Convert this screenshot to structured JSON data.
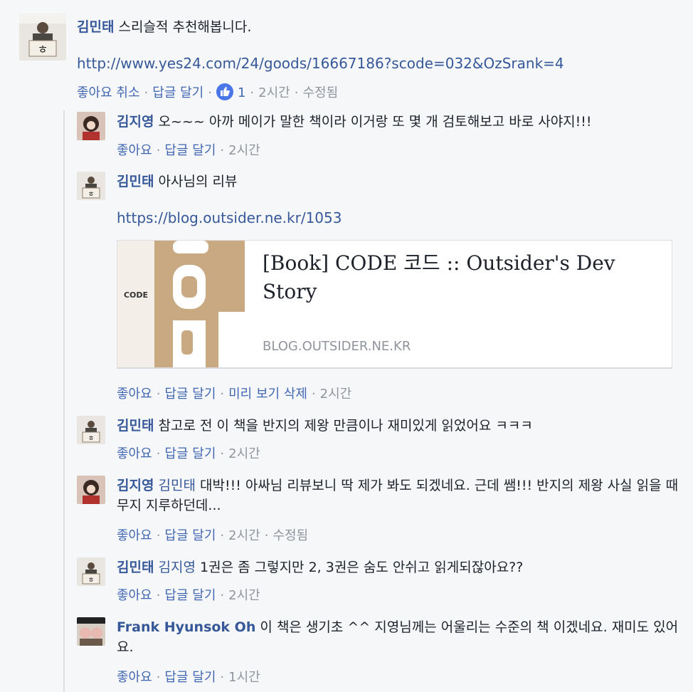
{
  "main_comment": {
    "author": "김민태",
    "text": "스리슬적 추천해봅니다.",
    "link": "http://www.yes24.com/24/goods/16667186?scode=032&OzSrank=4",
    "actions": {
      "like": "좋아요 취소",
      "reply": "답글 달기",
      "like_count": "1",
      "time": "2시간",
      "edited": "수정됨"
    }
  },
  "replies": [
    {
      "author": "김지영",
      "text": "오~~~ 아까 메이가 말한 책이라 이거랑 또 몇 개 검토해보고 바로 사야지!!!",
      "actions": {
        "like": "좋아요",
        "reply": "답글 달기",
        "time": "2시간"
      }
    },
    {
      "author": "김민태",
      "text": "아사님의 리뷰",
      "link": "https://blog.outsider.ne.kr/1053",
      "card": {
        "title": "[Book] CODE 코드 :: Outsider's Dev Story",
        "domain": "BLOG.OUTSIDER.NE.KR",
        "image_text": "CODE"
      },
      "actions": {
        "like": "좋아요",
        "reply": "답글 달기",
        "remove_preview": "미리 보기 삭제",
        "time": "2시간"
      }
    },
    {
      "author": "김민태",
      "text": "참고로 전 이 책을 반지의 제왕 만큼이나 재미있게 읽었어요 ㅋㅋㅋ",
      "actions": {
        "like": "좋아요",
        "reply": "답글 달기",
        "time": "2시간"
      }
    },
    {
      "author": "김지영",
      "mention": "김민태",
      "text": "대박!!! 아싸님 리뷰보니 딱 제가 봐도 되겠네요. 근데 쌤!!! 반지의 제왕 사실 읽을 때 무지 지루하던데...",
      "actions": {
        "like": "좋아요",
        "reply": "답글 달기",
        "time": "2시간",
        "edited": "수정됨"
      }
    },
    {
      "author": "김민태",
      "mention": "김지영",
      "text": "1권은 좀 그렇지만 2, 3권은 숨도 안쉬고 읽게되잖아요??",
      "actions": {
        "like": "좋아요",
        "reply": "답글 달기",
        "time": "2시간"
      }
    },
    {
      "author": "Frank Hyunsok Oh",
      "text": "이 책은 생기초 ^^ 지영님께는 어울리는 수준의 책 이겠네요. 재미도 있어요.",
      "actions": {
        "like": "좋아요",
        "reply": "답글 달기",
        "time": "1시간"
      }
    }
  ],
  "avatar_glyph": "ㅎ",
  "colors": {
    "link": "#365899",
    "action": "#4267b2",
    "meta": "#90949c",
    "background": "#f6f7f9"
  }
}
